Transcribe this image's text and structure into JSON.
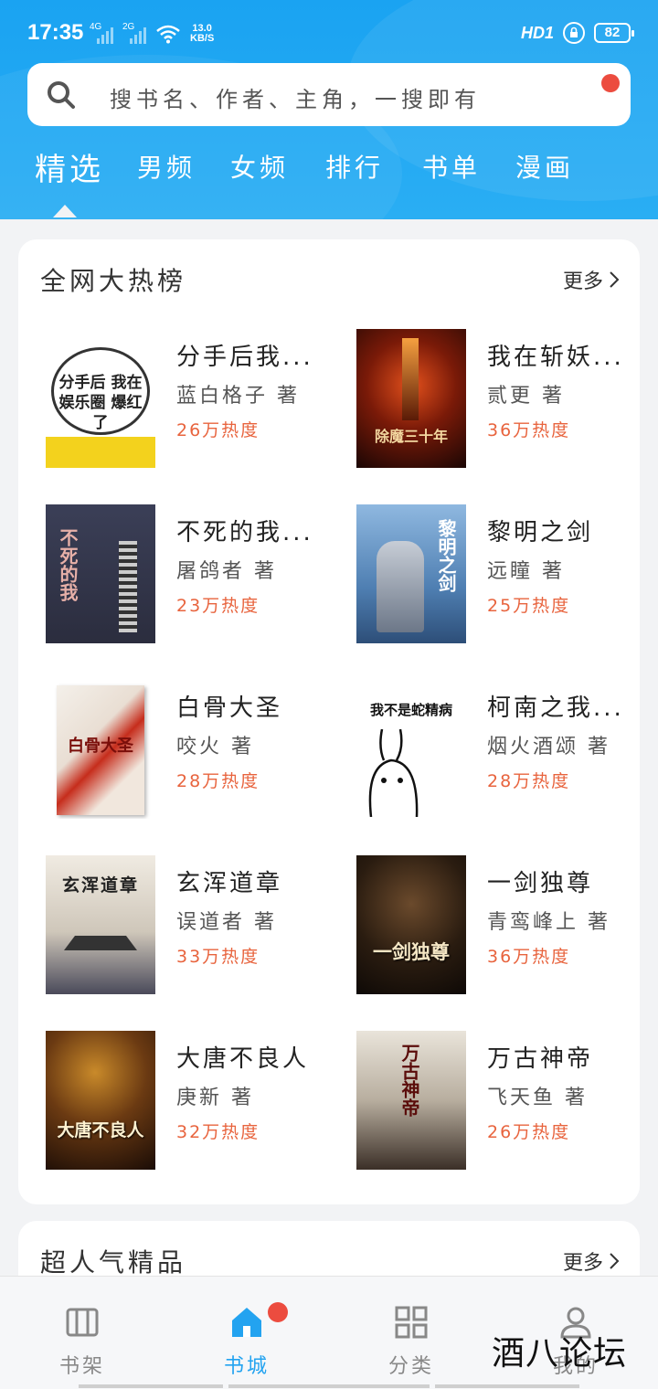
{
  "status": {
    "time": "17:35",
    "net1": "4G",
    "net2": "2G",
    "speed_value": "13.0",
    "speed_unit": "KB/S",
    "hd": "HD1",
    "battery": "82"
  },
  "search": {
    "placeholder": "搜书名、作者、主角，一搜即有"
  },
  "tabs": [
    "精选",
    "男频",
    "女频",
    "排行",
    "书单",
    "漫画"
  ],
  "section": {
    "title": "全网大热榜",
    "more": "更多"
  },
  "books": [
    {
      "title": "分手后我...",
      "author": "蓝白格子 著",
      "heat": "26万热度",
      "cover_text": "分手后 我在娱乐圈 爆红了"
    },
    {
      "title": "我在斩妖...",
      "author": "贰更 著",
      "heat": "36万热度",
      "cover_text": "除魔三十年"
    },
    {
      "title": "不死的我...",
      "author": "屠鸽者 著",
      "heat": "23万热度",
      "cover_text": "不死的我"
    },
    {
      "title": "黎明之剑",
      "author": "远瞳 著",
      "heat": "25万热度",
      "cover_text": "黎明之剑"
    },
    {
      "title": "白骨大圣",
      "author": "咬火 著",
      "heat": "28万热度",
      "cover_text": "白骨大圣"
    },
    {
      "title": "柯南之我...",
      "author": "烟火酒颂 著",
      "heat": "28万热度",
      "cover_text": "我不是蛇精病"
    },
    {
      "title": "玄浑道章",
      "author": "误道者 著",
      "heat": "33万热度",
      "cover_text": "玄浑道章"
    },
    {
      "title": "一剑独尊",
      "author": "青鸾峰上 著",
      "heat": "36万热度",
      "cover_text": "一剑独尊"
    },
    {
      "title": "大唐不良人",
      "author": "庚新 著",
      "heat": "32万热度",
      "cover_text": "大唐不良人"
    },
    {
      "title": "万古神帝",
      "author": "飞天鱼 著",
      "heat": "26万热度",
      "cover_text": "万古神帝"
    }
  ],
  "section2": {
    "title": "超人气精品",
    "more": "更多"
  },
  "nav": [
    {
      "label": "书架",
      "icon": "bookshelf-icon"
    },
    {
      "label": "书城",
      "icon": "home-icon"
    },
    {
      "label": "分类",
      "icon": "category-icon"
    },
    {
      "label": "我的",
      "icon": "profile-icon"
    }
  ],
  "watermark": "酒八论坛",
  "colors": {
    "accent": "#23a3f0",
    "heat": "#e8643e",
    "badge": "#ec4c3f"
  }
}
